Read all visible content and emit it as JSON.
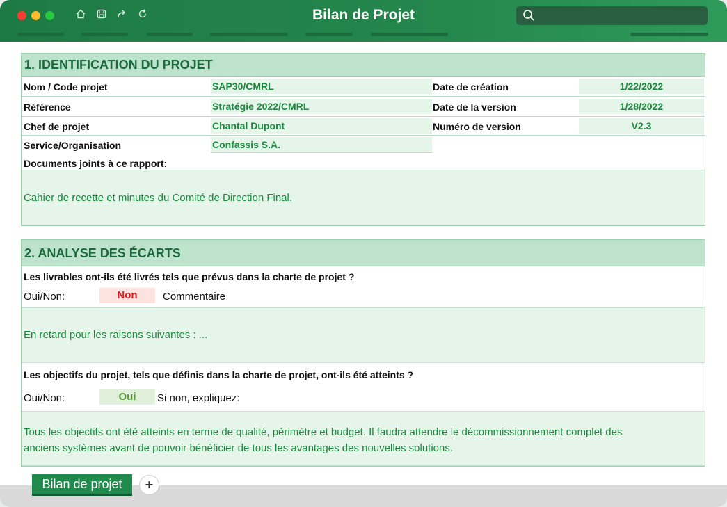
{
  "window": {
    "title": "Bilan de Projet",
    "search": {
      "value": "",
      "placeholder": ""
    },
    "toolbar_icons": [
      "home-icon",
      "save-icon",
      "share-icon",
      "refresh-icon"
    ],
    "colors": {
      "accent": "#1e7a45",
      "header_fill": "#bde3cd",
      "value_text": "#1b8a3e",
      "no": "#e01a1a",
      "yes": "#5b9a3a"
    }
  },
  "section1": {
    "heading": "1. IDENTIFICATION DU PROJET",
    "rows": [
      {
        "label": "Nom / Code projet",
        "value": "SAP30/CMRL",
        "right_label": "Date de création",
        "right_value": "1/22/2022"
      },
      {
        "label": "Référence",
        "value": "Stratégie 2022/CMRL",
        "right_label": "Date de la version",
        "right_value": "1/28/2022"
      },
      {
        "label": "Chef de projet",
        "value": "Chantal Dupont",
        "right_label": "Numéro de version",
        "right_value": "V2.3"
      },
      {
        "label": "Service/Organisation",
        "value": "Confassis S.A."
      }
    ],
    "attachments_label": "Documents joints à ce rapport:",
    "attachments_text": "Cahier de recette et minutes du Comité de Direction Final."
  },
  "section2": {
    "heading": "2. ANALYSE DES ÉCARTS",
    "q1": {
      "question": "Les livrables ont-ils été livrés tels que prévus dans la charte de projet ?",
      "yn_label": "Oui/Non:",
      "answer": "Non",
      "after_label": "Commentaire",
      "comment": "En retard pour les raisons suivantes : ..."
    },
    "q2": {
      "question": "Les objectifs du projet, tels que définis dans la charte de projet, ont-ils été atteints ?",
      "yn_label": "Oui/Non:",
      "answer": "Oui",
      "after_label": "Si non, expliquez:",
      "comment_line1": "Tous les objectifs ont été atteints en terme de qualité, périmètre et budget. Il faudra attendre le décommissionnement complet des",
      "comment_line2": "anciens systèmes avant de pouvoir bénéficier de tous les avantages des nouvelles solutions."
    }
  },
  "tabs": {
    "active": "Bilan de projet",
    "add": "+"
  }
}
